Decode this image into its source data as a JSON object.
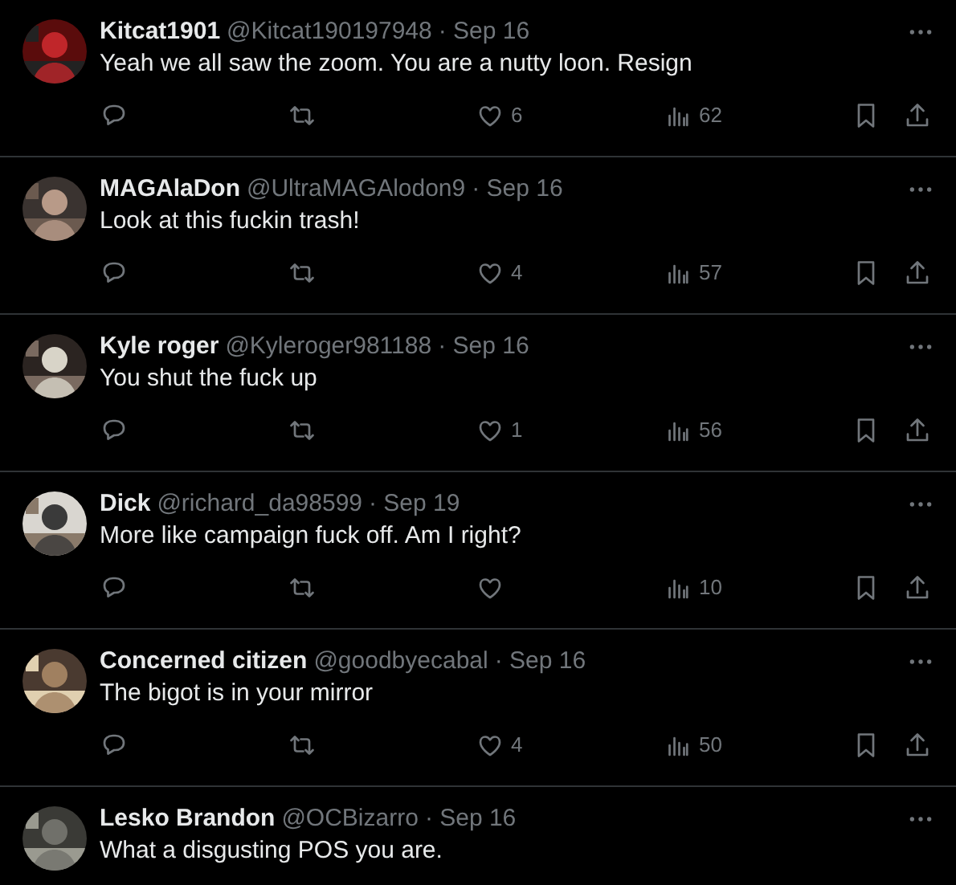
{
  "replies": [
    {
      "name": "Kitcat1901",
      "handle": "@Kitcat190197948",
      "date": "· Sep 16",
      "text": "Yeah we all saw the zoom. You are a nutty loon. Resign",
      "actions": {
        "likes": "6",
        "views": "62"
      }
    },
    {
      "name": "MAGAlaDon",
      "handle": "@UltraMAGAlodon9",
      "date": "· Sep 16",
      "text": "Look at this fuckin trash!",
      "actions": {
        "likes": "4",
        "views": "57"
      }
    },
    {
      "name": "Kyle roger",
      "handle": "@Kyleroger981188",
      "date": "· Sep 16",
      "text": "You shut the fuck up",
      "actions": {
        "likes": "1",
        "views": "56"
      }
    },
    {
      "name": "Dick",
      "handle": "@richard_da98599",
      "date": "· Sep 19",
      "text": "More like campaign fuck off. Am I right?",
      "actions": {
        "views": "10"
      }
    },
    {
      "name": "Concerned citizen",
      "handle": "@goodbyecabal",
      "date": "· Sep 16",
      "text": "The bigot is in your mirror",
      "actions": {
        "likes": "4",
        "views": "50"
      }
    },
    {
      "name": "Lesko Brandon",
      "handle": "@OCBizarro",
      "date": "· Sep 16",
      "text": "What a disgusting POS you are."
    }
  ]
}
